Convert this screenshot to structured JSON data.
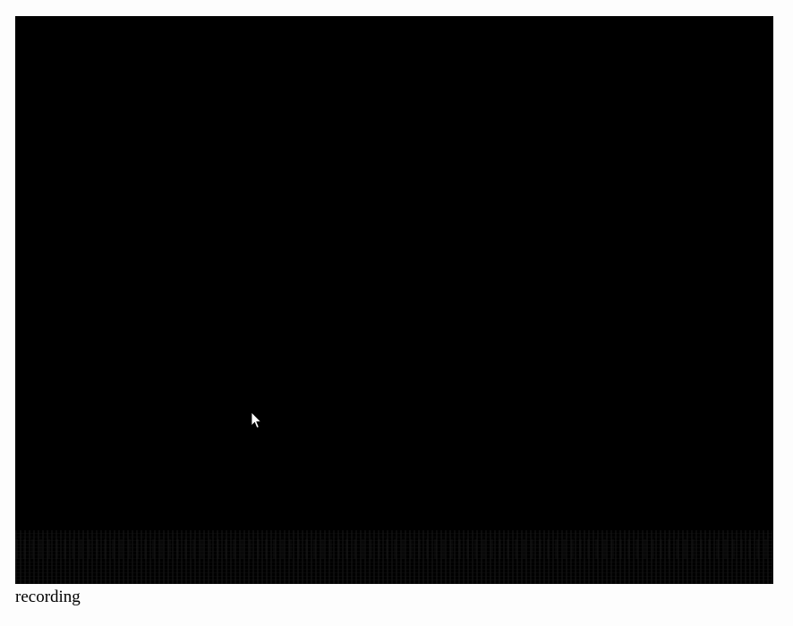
{
  "screen": {
    "background": "#000000",
    "cursor_icon": "arrow-cursor-icon"
  },
  "caption": {
    "text": "recording"
  }
}
